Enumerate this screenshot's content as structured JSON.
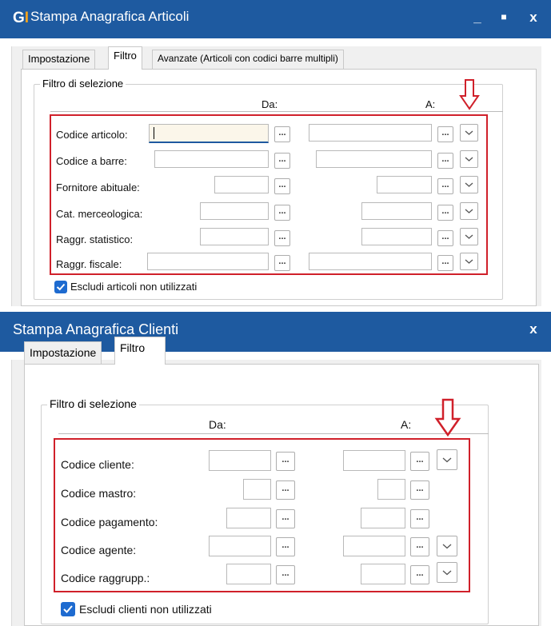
{
  "win1": {
    "title": "Stampa Anagrafica Articoli",
    "logo": "G",
    "logo_mark": "I",
    "tabs": [
      "Impostazione",
      "Filtro",
      "Avanzate (Articoli con codici barre multipli)"
    ],
    "group_title": "Filtro di selezione",
    "col_from": "Da:",
    "col_to": "A:",
    "rows": [
      {
        "label": "Codice articolo:"
      },
      {
        "label": "Codice a barre:"
      },
      {
        "label": "Fornitore abituale:"
      },
      {
        "label": "Cat. merceologica:"
      },
      {
        "label": "Raggr. statistico:"
      },
      {
        "label": "Raggr. fiscale:"
      }
    ],
    "checkbox_label": "Escludi articoli non utilizzati",
    "checkbox_checked": true
  },
  "win2": {
    "title": "Stampa Anagrafica Clienti",
    "tabs": [
      "Impostazione",
      "Filtro"
    ],
    "group_title": "Filtro di selezione",
    "col_from": "Da:",
    "col_to": "A:",
    "rows": [
      {
        "label": "Codice cliente:"
      },
      {
        "label": "Codice mastro:"
      },
      {
        "label": "Codice pagamento:"
      },
      {
        "label": "Codice agente:"
      },
      {
        "label": "Codice raggrupp.:"
      }
    ],
    "checkbox_label": "Escludi clienti non utilizzati",
    "checkbox_checked": true
  },
  "buttons": {
    "ellipsis": "...",
    "minimize": "_",
    "maximize": "■",
    "close": "x"
  },
  "colors": {
    "titlebar": "#1e5aa0",
    "highlight": "#d0202a",
    "accent": "#f7a21a"
  }
}
